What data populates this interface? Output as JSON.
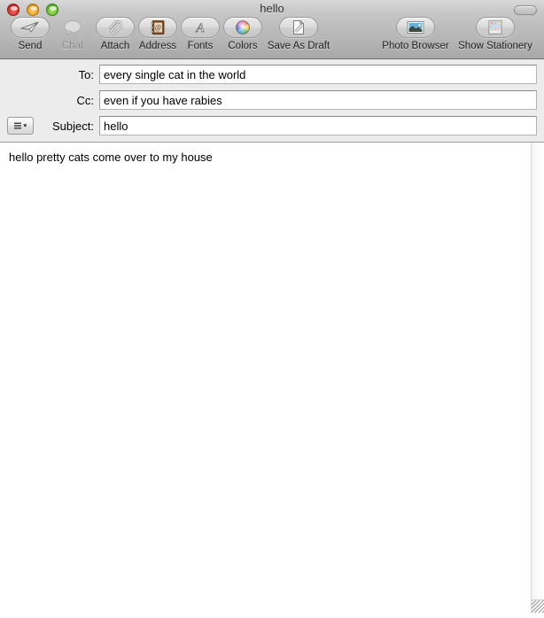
{
  "window": {
    "title": "hello",
    "controls": [
      {
        "name": "close",
        "color": "#d9342c"
      },
      {
        "name": "minimize",
        "color": "#eda220"
      },
      {
        "name": "zoom",
        "color": "#68c030"
      }
    ],
    "toolbar_toggle_label": ""
  },
  "toolbar": {
    "left_items": [
      {
        "label": "Send",
        "icon": "send-paper-plane-icon",
        "enabled": true
      },
      {
        "label": "Chat",
        "icon": "chat-bubble-icon",
        "enabled": false
      },
      {
        "label": "Attach",
        "icon": "paperclip-icon",
        "enabled": true
      },
      {
        "label": "Address",
        "icon": "address-book-icon",
        "enabled": true
      },
      {
        "label": "Fonts",
        "icon": "fonts-letter-a-icon",
        "enabled": true
      },
      {
        "label": "Colors",
        "icon": "color-wheel-icon",
        "enabled": true
      },
      {
        "label": "Save As Draft",
        "icon": "draft-page-icon",
        "enabled": true
      }
    ],
    "right_items": [
      {
        "label": "Photo Browser",
        "icon": "photo-browser-icon",
        "enabled": true
      },
      {
        "label": "Show Stationery",
        "icon": "stationery-icon",
        "enabled": true
      }
    ]
  },
  "headers": {
    "to": {
      "label": "To:",
      "value": "every single cat in the world",
      "placeholder": ""
    },
    "cc": {
      "label": "Cc:",
      "value": "even if you have rabies",
      "placeholder": ""
    },
    "subject": {
      "label": "Subject:",
      "value": "hello",
      "placeholder": ""
    },
    "options_button_icon": "header-options-menu-icon"
  },
  "message": {
    "body": "hello pretty cats come over to my house"
  }
}
